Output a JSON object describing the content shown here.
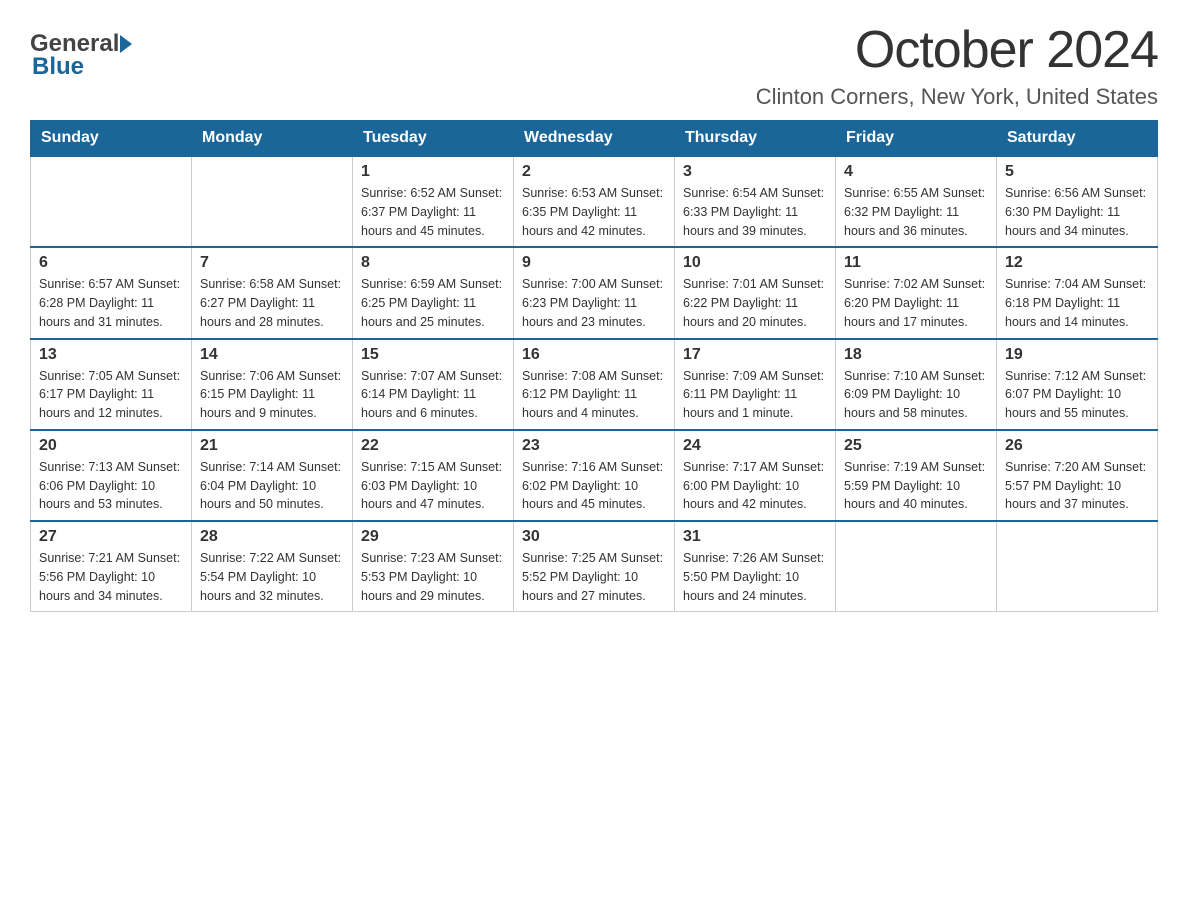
{
  "header": {
    "logo_general": "General",
    "logo_blue": "Blue",
    "month_title": "October 2024",
    "location": "Clinton Corners, New York, United States"
  },
  "days_of_week": [
    "Sunday",
    "Monday",
    "Tuesday",
    "Wednesday",
    "Thursday",
    "Friday",
    "Saturday"
  ],
  "weeks": [
    [
      {
        "day": "",
        "info": ""
      },
      {
        "day": "",
        "info": ""
      },
      {
        "day": "1",
        "info": "Sunrise: 6:52 AM\nSunset: 6:37 PM\nDaylight: 11 hours\nand 45 minutes."
      },
      {
        "day": "2",
        "info": "Sunrise: 6:53 AM\nSunset: 6:35 PM\nDaylight: 11 hours\nand 42 minutes."
      },
      {
        "day": "3",
        "info": "Sunrise: 6:54 AM\nSunset: 6:33 PM\nDaylight: 11 hours\nand 39 minutes."
      },
      {
        "day": "4",
        "info": "Sunrise: 6:55 AM\nSunset: 6:32 PM\nDaylight: 11 hours\nand 36 minutes."
      },
      {
        "day": "5",
        "info": "Sunrise: 6:56 AM\nSunset: 6:30 PM\nDaylight: 11 hours\nand 34 minutes."
      }
    ],
    [
      {
        "day": "6",
        "info": "Sunrise: 6:57 AM\nSunset: 6:28 PM\nDaylight: 11 hours\nand 31 minutes."
      },
      {
        "day": "7",
        "info": "Sunrise: 6:58 AM\nSunset: 6:27 PM\nDaylight: 11 hours\nand 28 minutes."
      },
      {
        "day": "8",
        "info": "Sunrise: 6:59 AM\nSunset: 6:25 PM\nDaylight: 11 hours\nand 25 minutes."
      },
      {
        "day": "9",
        "info": "Sunrise: 7:00 AM\nSunset: 6:23 PM\nDaylight: 11 hours\nand 23 minutes."
      },
      {
        "day": "10",
        "info": "Sunrise: 7:01 AM\nSunset: 6:22 PM\nDaylight: 11 hours\nand 20 minutes."
      },
      {
        "day": "11",
        "info": "Sunrise: 7:02 AM\nSunset: 6:20 PM\nDaylight: 11 hours\nand 17 minutes."
      },
      {
        "day": "12",
        "info": "Sunrise: 7:04 AM\nSunset: 6:18 PM\nDaylight: 11 hours\nand 14 minutes."
      }
    ],
    [
      {
        "day": "13",
        "info": "Sunrise: 7:05 AM\nSunset: 6:17 PM\nDaylight: 11 hours\nand 12 minutes."
      },
      {
        "day": "14",
        "info": "Sunrise: 7:06 AM\nSunset: 6:15 PM\nDaylight: 11 hours\nand 9 minutes."
      },
      {
        "day": "15",
        "info": "Sunrise: 7:07 AM\nSunset: 6:14 PM\nDaylight: 11 hours\nand 6 minutes."
      },
      {
        "day": "16",
        "info": "Sunrise: 7:08 AM\nSunset: 6:12 PM\nDaylight: 11 hours\nand 4 minutes."
      },
      {
        "day": "17",
        "info": "Sunrise: 7:09 AM\nSunset: 6:11 PM\nDaylight: 11 hours\nand 1 minute."
      },
      {
        "day": "18",
        "info": "Sunrise: 7:10 AM\nSunset: 6:09 PM\nDaylight: 10 hours\nand 58 minutes."
      },
      {
        "day": "19",
        "info": "Sunrise: 7:12 AM\nSunset: 6:07 PM\nDaylight: 10 hours\nand 55 minutes."
      }
    ],
    [
      {
        "day": "20",
        "info": "Sunrise: 7:13 AM\nSunset: 6:06 PM\nDaylight: 10 hours\nand 53 minutes."
      },
      {
        "day": "21",
        "info": "Sunrise: 7:14 AM\nSunset: 6:04 PM\nDaylight: 10 hours\nand 50 minutes."
      },
      {
        "day": "22",
        "info": "Sunrise: 7:15 AM\nSunset: 6:03 PM\nDaylight: 10 hours\nand 47 minutes."
      },
      {
        "day": "23",
        "info": "Sunrise: 7:16 AM\nSunset: 6:02 PM\nDaylight: 10 hours\nand 45 minutes."
      },
      {
        "day": "24",
        "info": "Sunrise: 7:17 AM\nSunset: 6:00 PM\nDaylight: 10 hours\nand 42 minutes."
      },
      {
        "day": "25",
        "info": "Sunrise: 7:19 AM\nSunset: 5:59 PM\nDaylight: 10 hours\nand 40 minutes."
      },
      {
        "day": "26",
        "info": "Sunrise: 7:20 AM\nSunset: 5:57 PM\nDaylight: 10 hours\nand 37 minutes."
      }
    ],
    [
      {
        "day": "27",
        "info": "Sunrise: 7:21 AM\nSunset: 5:56 PM\nDaylight: 10 hours\nand 34 minutes."
      },
      {
        "day": "28",
        "info": "Sunrise: 7:22 AM\nSunset: 5:54 PM\nDaylight: 10 hours\nand 32 minutes."
      },
      {
        "day": "29",
        "info": "Sunrise: 7:23 AM\nSunset: 5:53 PM\nDaylight: 10 hours\nand 29 minutes."
      },
      {
        "day": "30",
        "info": "Sunrise: 7:25 AM\nSunset: 5:52 PM\nDaylight: 10 hours\nand 27 minutes."
      },
      {
        "day": "31",
        "info": "Sunrise: 7:26 AM\nSunset: 5:50 PM\nDaylight: 10 hours\nand 24 minutes."
      },
      {
        "day": "",
        "info": ""
      },
      {
        "day": "",
        "info": ""
      }
    ]
  ]
}
